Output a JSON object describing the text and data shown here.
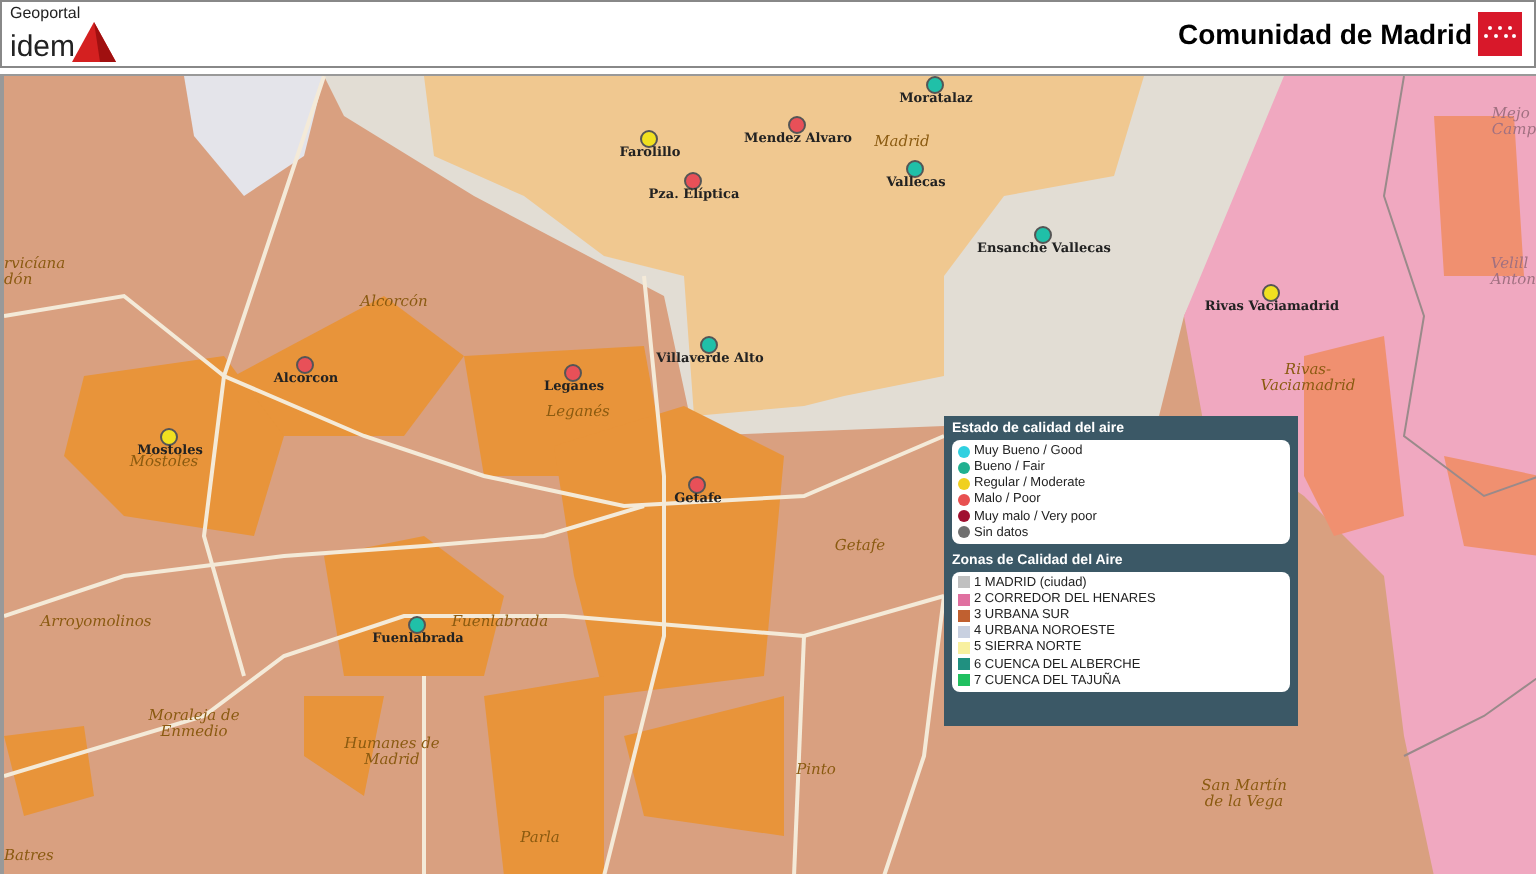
{
  "header": {
    "logo_small": "Geoportal",
    "logo_large": "idem",
    "brand": "Comunidad de Madrid"
  },
  "stations": [
    {
      "name": "Moratalaz",
      "color": "#20c0a8"
    },
    {
      "name": "Farolillo",
      "color": "#f0e020"
    },
    {
      "name": "Mendez Alvaro",
      "color": "#e85058"
    },
    {
      "name": "Pza. Elíptica",
      "color": "#e85058"
    },
    {
      "name": "Vallecas",
      "color": "#20c0a8"
    },
    {
      "name": "Ensanche Vallecas",
      "color": "#20c0a8"
    },
    {
      "name": "Rivas Vaciamadrid",
      "color": "#f0e020"
    },
    {
      "name": "Villaverde Alto",
      "color": "#20c0a8"
    },
    {
      "name": "Alcorcon",
      "color": "#e85058"
    },
    {
      "name": "Leganes",
      "color": "#e85058"
    },
    {
      "name": "Mostoles",
      "color": "#f0e020"
    },
    {
      "name": "Getafe",
      "color": "#e85058"
    },
    {
      "name": "Fuenlabrada",
      "color": "#20c0a8"
    }
  ],
  "places": [
    "Madrid",
    "Alcorcón",
    "Leganés",
    "Móstoles",
    "Getafe",
    "Fuenlabrada",
    "Arroyomolinos",
    "Moraleja de\nEnmedio",
    "Humanes de\nMadrid",
    "Parla",
    "Pinto",
    "San Martín\nde la Vega",
    "Rivas-\nVaciamadrid",
    "Mejo\nCamp",
    "Velill\nAnton",
    "rvicíana\ndón",
    "Batres"
  ],
  "legend": {
    "status_title": "Estado de calidad del aire",
    "statuses": [
      {
        "label": "Muy Bueno / Good",
        "color": "#30d0e0"
      },
      {
        "label": "Bueno / Fair",
        "color": "#20b090"
      },
      {
        "label": "Regular / Moderate",
        "color": "#f0d020"
      },
      {
        "label": "Malo / Poor",
        "color": "#e85050"
      },
      {
        "label": "Muy malo / Very poor",
        "color": "#a01030"
      },
      {
        "label": "Sin datos",
        "color": "#707070"
      }
    ],
    "zones_title": "Zonas de Calidad del Aire",
    "zones": [
      {
        "label": "1 MADRID (ciudad)",
        "color": "#c0c0c0"
      },
      {
        "label": "2 CORREDOR DEL HENARES",
        "color": "#e070a0"
      },
      {
        "label": "3 URBANA SUR",
        "color": "#c06030"
      },
      {
        "label": "4 URBANA NOROESTE",
        "color": "#c8d0e0"
      },
      {
        "label": "5 SIERRA NORTE",
        "color": "#f8f0a0"
      },
      {
        "label": "6 CUENCA DEL ALBERCHE",
        "color": "#209080"
      },
      {
        "label": "7 CUENCA DEL TAJUÑA",
        "color": "#20c060"
      }
    ]
  }
}
